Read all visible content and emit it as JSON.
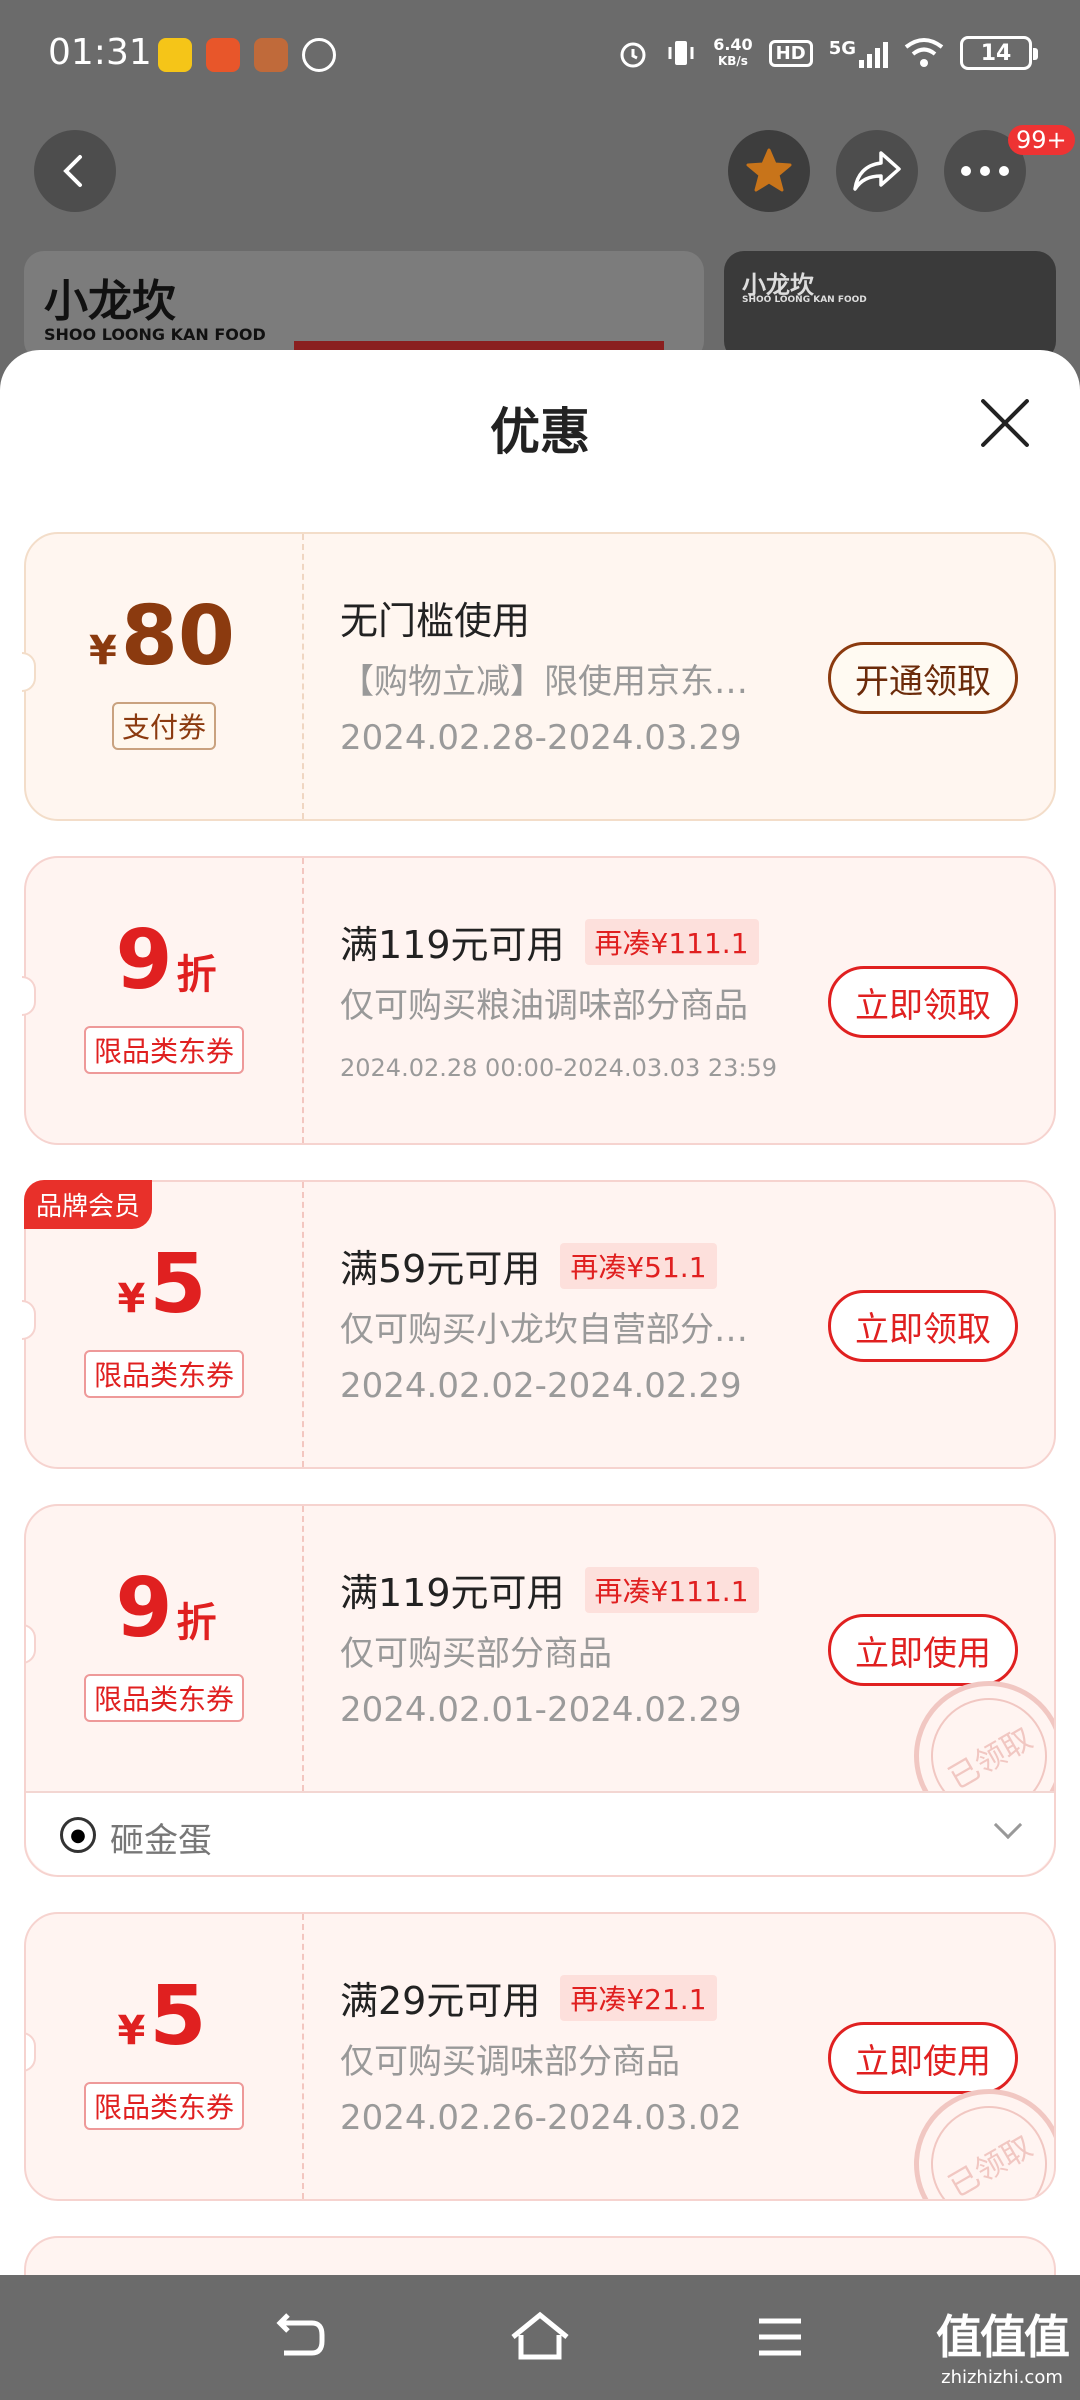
{
  "status": {
    "time": "01:31",
    "net_speed_value": "6.40",
    "net_speed_unit": "KB/s",
    "hd": "HD",
    "network": "5G",
    "battery": "14"
  },
  "header": {
    "more_badge": "99+",
    "banner_logo": "小龙坎",
    "banner_sub": "SHOO LOONG KAN FOOD"
  },
  "sheet": {
    "title": "优惠"
  },
  "coupons": [
    {
      "currency": "¥",
      "amount": "80",
      "unit": "",
      "type": "支付券",
      "condition": "无门槛使用",
      "need": "",
      "desc": "【购物立减】限使用京东…",
      "date": "2024.02.28-2024.03.29",
      "action": "开通领取"
    },
    {
      "currency": "",
      "amount": "9",
      "unit": "折",
      "type": "限品类东券",
      "condition": "满119元可用",
      "need": "再凑¥111.1",
      "desc": "仅可购买粮油调味部分商品",
      "date": "2024.02.28 00:00-2024.03.03 23:59",
      "action": "立即领取"
    },
    {
      "badge": "品牌会员",
      "currency": "¥",
      "amount": "5",
      "unit": "",
      "type": "限品类东券",
      "condition": "满59元可用",
      "need": "再凑¥51.1",
      "desc": "仅可购买小龙坎自营部分…",
      "date": "2024.02.02-2024.02.29",
      "action": "立即领取"
    },
    {
      "currency": "",
      "amount": "9",
      "unit": "折",
      "type": "限品类东券",
      "condition": "满119元可用",
      "need": "再凑¥111.1",
      "desc": "仅可购买部分商品",
      "date": "2024.02.01-2024.02.29",
      "action": "立即使用",
      "stamp": "已领取",
      "footer": "砸金蛋"
    },
    {
      "currency": "¥",
      "amount": "5",
      "unit": "",
      "type": "限品类东券",
      "condition": "满29元可用",
      "need": "再凑¥21.1",
      "desc": "仅可购买调味部分商品",
      "date": "2024.02.26-2024.03.02",
      "action": "立即使用",
      "stamp": "已领取"
    }
  ],
  "watermark": {
    "big": "值值值",
    "small": "zhizhizhi.com"
  },
  "colors": {
    "accent_red": "#e02020",
    "gold_brown": "#8b3a0f",
    "coupon_bg": "#fff4f1"
  }
}
